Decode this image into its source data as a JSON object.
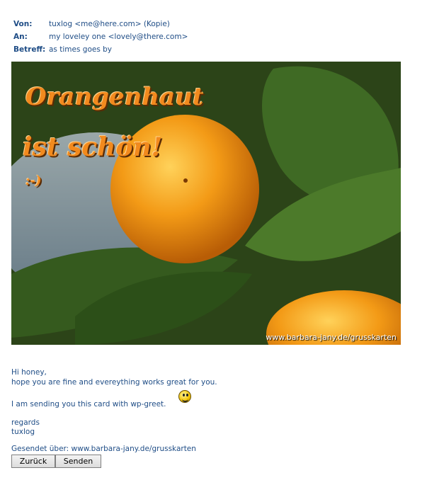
{
  "header": {
    "from_label": "Von:",
    "from_value": "tuxlog <me@here.com> (Kopie)",
    "to_label": "An:",
    "to_value": "my loveley one <lovely@there.com>",
    "subject_label": "Betreff:",
    "subject_value": "as times goes by"
  },
  "card": {
    "title_line1": "Orangenhaut",
    "title_line2": "ist schön!",
    "smiley_text": ":-)",
    "credit": "www.barbara-jany.de/grusskarten",
    "colors": {
      "frame": "#a35c12",
      "title": "#f28a1e",
      "orange": "#f39a16",
      "leaf": "#3f6a24"
    }
  },
  "message": {
    "greeting": "Hi honey,",
    "line1": "hope you are fine and evereything works great for you.",
    "line2": "I am sending you this card with wp-greet.",
    "smiley_icon": "grinning-smiley-icon",
    "regards": "regards",
    "signature": "tuxlog"
  },
  "footer": {
    "sent_via": "Gesendet über: www.barbara-jany.de/grusskarten"
  },
  "buttons": {
    "back": "Zurück",
    "send": "Senden"
  },
  "colors": {
    "text": "#1f4d86"
  }
}
